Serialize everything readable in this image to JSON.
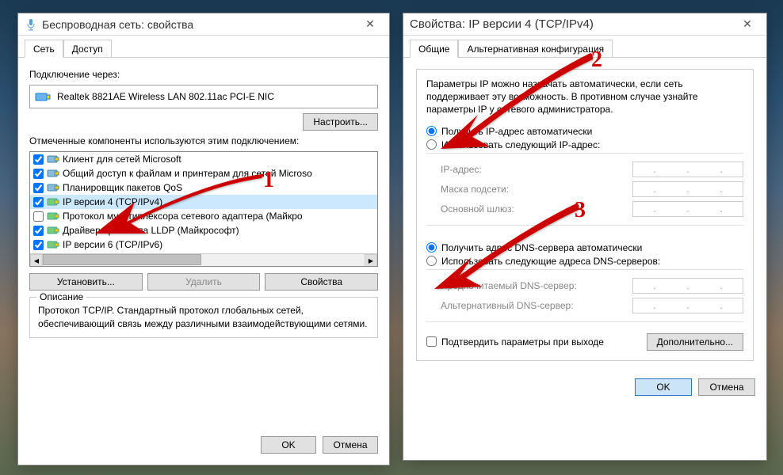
{
  "left": {
    "title": "Беспроводная сеть: свойства",
    "tabs": {
      "network": "Сеть",
      "access": "Доступ"
    },
    "conn_via": "Подключение через:",
    "adapter": "Realtek 8821AE Wireless LAN 802.11ac PCI-E NIC",
    "configure": "Настроить...",
    "components_label": "Отмеченные компоненты используются этим подключением:",
    "components": [
      {
        "checked": true,
        "label": "Клиент для сетей Microsoft",
        "icon": "blue"
      },
      {
        "checked": true,
        "label": "Общий доступ к файлам и принтерам для сетей Microso",
        "icon": "blue"
      },
      {
        "checked": true,
        "label": "Планировщик пакетов QoS",
        "icon": "blue"
      },
      {
        "checked": true,
        "label": "IP версии 4 (TCP/IPv4)",
        "icon": "green",
        "selected": true
      },
      {
        "checked": false,
        "label": "Протокол мультиплексора сетевого адаптера (Майкро",
        "icon": "green"
      },
      {
        "checked": true,
        "label": "Драйвер протокола LLDP (Майкрософт)",
        "icon": "green"
      },
      {
        "checked": true,
        "label": "IP версии 6 (TCP/IPv6)",
        "icon": "green"
      }
    ],
    "install": "Установить...",
    "remove": "Удалить",
    "properties": "Свойства",
    "desc_title": "Описание",
    "desc_text": "Протокол TCP/IP. Стандартный протокол глобальных сетей, обеспечивающий связь между различными взаимодействующими сетями.",
    "ok": "OK",
    "cancel": "Отмена"
  },
  "right": {
    "title": "Свойства: IP версии 4 (TCP/IPv4)",
    "tabs": {
      "general": "Общие",
      "alt": "Альтернативная конфигурация"
    },
    "intro": "Параметры IP можно назначать автоматически, если сеть поддерживает эту возможность. В противном случае узнайте параметры IP у сетевого администратора.",
    "auto_ip": "Получить IP-адрес автоматически",
    "manual_ip": "Использовать следующий IP-адрес:",
    "ip_addr": "IP-адрес:",
    "mask": "Маска подсети:",
    "gateway": "Основной шлюз:",
    "auto_dns": "Получить адрес DNS-сервера автоматически",
    "manual_dns": "Использовать следующие адреса DNS-серверов:",
    "pref_dns": "Предпочитаемый DNS-сервер:",
    "alt_dns": "Альтернативный DNS-сервер:",
    "confirm_exit": "Подтвердить параметры при выходе",
    "advanced": "Дополнительно...",
    "ok": "OK",
    "cancel": "Отмена"
  },
  "annotations": {
    "a1": "1",
    "a2": "2",
    "a3": "3"
  }
}
